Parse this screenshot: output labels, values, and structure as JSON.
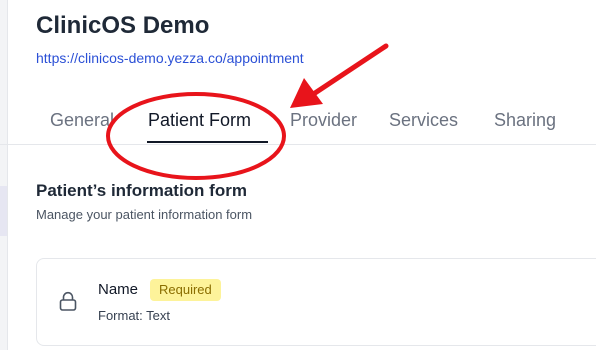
{
  "app": {
    "title": "ClinicOS Demo",
    "url": "https://clinicos-demo.yezza.co/appointment"
  },
  "tabs": [
    {
      "label": "General",
      "active": false
    },
    {
      "label": "Patient Form",
      "active": true
    },
    {
      "label": "Provider",
      "active": false
    },
    {
      "label": "Services",
      "active": false
    },
    {
      "label": "Sharing",
      "active": false
    }
  ],
  "section": {
    "title": "Patient’s information form",
    "subtitle": "Manage your patient information form"
  },
  "fields": [
    {
      "name": "Name",
      "badge": "Required",
      "format": "Format: Text",
      "icon": "lock-icon"
    }
  ],
  "colors": {
    "link": "#2b50d6",
    "annotation": "#e8141b",
    "badge_bg": "#fdf39a",
    "badge_text": "#8a6d00",
    "active_tab": "#111827",
    "inactive_tab": "#6b7280"
  }
}
